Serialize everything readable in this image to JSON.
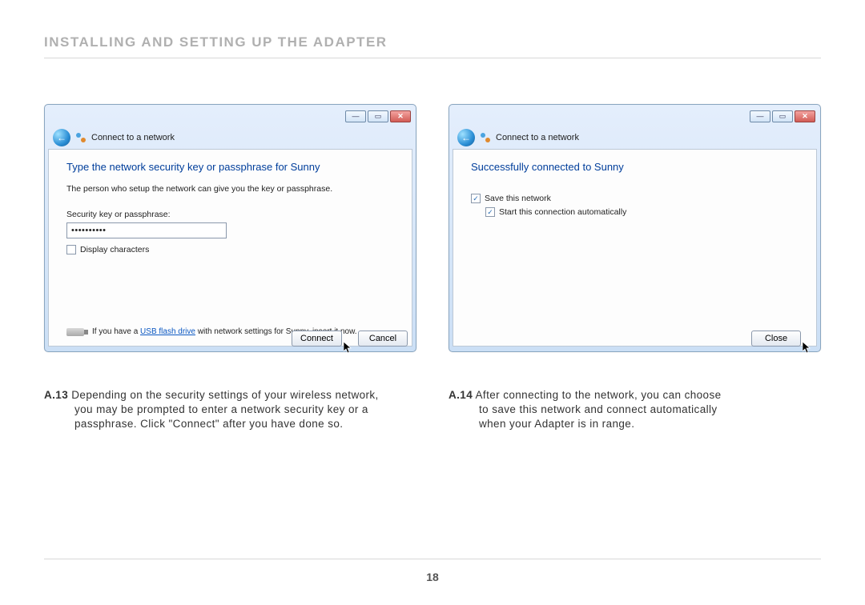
{
  "page": {
    "title": "INSTALLING AND SETTING UP THE ADAPTER",
    "number": "18"
  },
  "left": {
    "breadcrumb": "Connect to a network",
    "heading": "Type the network security key or passphrase for Sunny",
    "subtext": "The person who setup the network can give you the key or passphrase.",
    "field_label": "Security key or passphrase:",
    "password_masked": "••••••••••",
    "display_chars_label": "Display characters",
    "display_chars_checked": false,
    "usb_note_prefix": "If you have a ",
    "usb_note_link": "USB flash drive",
    "usb_note_suffix": " with network settings for Sunny, insert it now.",
    "btn_connect": "Connect",
    "btn_cancel": "Cancel",
    "caption_num": "A.13",
    "caption_first": " Depending on the security settings of your wireless network,",
    "caption_line2": "you may be prompted to enter a network security key or a",
    "caption_line3": "passphrase. Click \"Connect\" after you have done so."
  },
  "right": {
    "breadcrumb": "Connect to a network",
    "heading": "Successfully connected to Sunny",
    "save_label": "Save this network",
    "save_checked": true,
    "auto_label": "Start this connection automatically",
    "auto_checked": true,
    "btn_close": "Close",
    "caption_num": "A.14",
    "caption_first": " After connecting to the network, you can choose",
    "caption_line2": "to save this network and connect automatically",
    "caption_line3": "when your Adapter is in range."
  }
}
